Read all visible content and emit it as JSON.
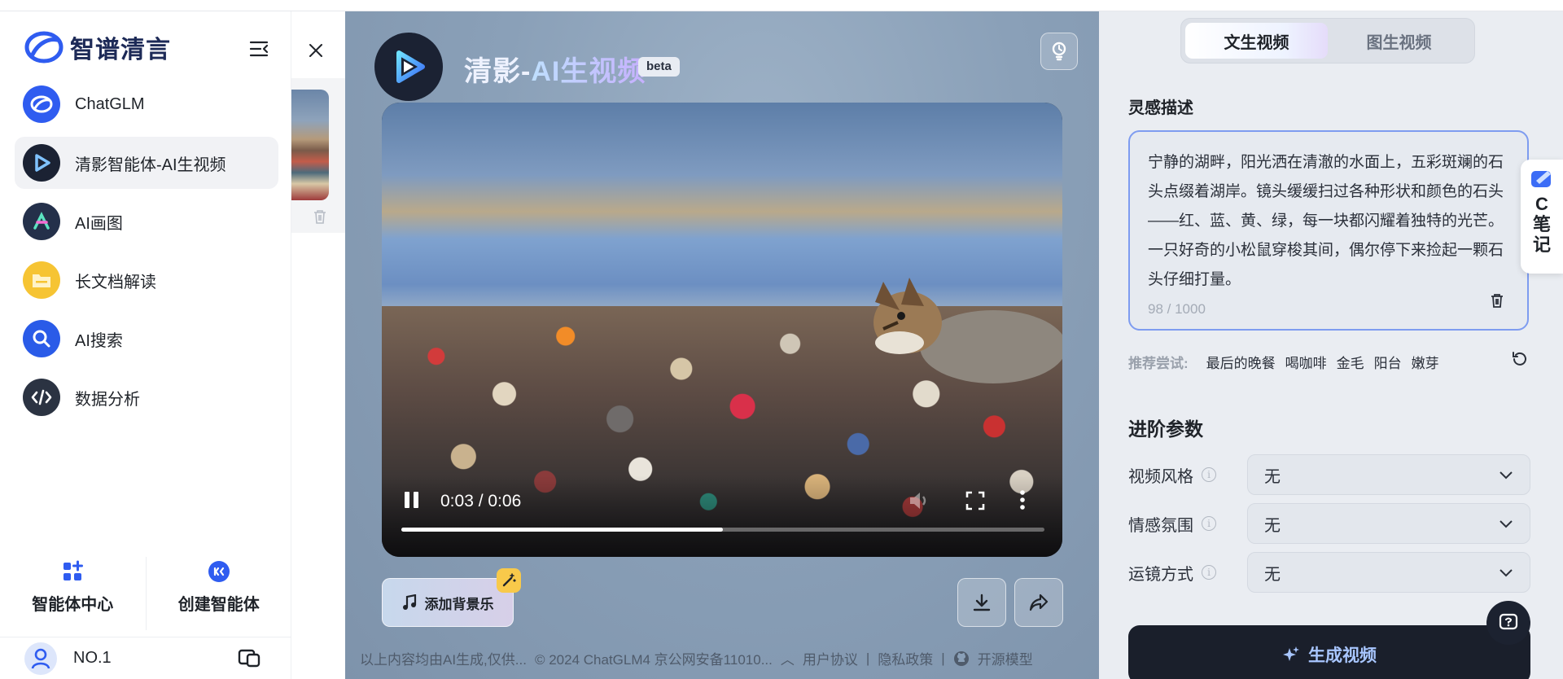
{
  "sidebar": {
    "brand": "智谱清言",
    "items": [
      {
        "label": "ChatGLM"
      },
      {
        "label": "清影智能体-AI生视频"
      },
      {
        "label": "AI画图"
      },
      {
        "label": "长文档解读"
      },
      {
        "label": "AI搜索"
      },
      {
        "label": "数据分析"
      }
    ],
    "tools": [
      {
        "label": "智能体中心"
      },
      {
        "label": "创建智能体"
      }
    ],
    "user": {
      "name": "NO.1"
    }
  },
  "app": {
    "title_main": "清影-",
    "title_grad": "AI生视频",
    "badge": "beta"
  },
  "video": {
    "time": "0:03 / 0:06",
    "progress": 0.5
  },
  "actions": {
    "bgm_label": "添加背景乐"
  },
  "footer": {
    "disclaimer": "以上内容均由AI生成,仅供...",
    "copyright": "© 2024 ChatGLM4 京公网安备11010...",
    "links": [
      "用户协议",
      "隐私政策",
      "开源模型"
    ]
  },
  "panel": {
    "tabs": [
      {
        "label": "文生视频",
        "active": true
      },
      {
        "label": "图生视频",
        "active": false
      }
    ],
    "prompt_title": "灵感描述",
    "prompt_text": "宁静的湖畔，阳光洒在清澈的水面上，五彩斑斓的石头点缀着湖岸。镜头缓缓扫过各种形状和颜色的石头——红、蓝、黄、绿，每一块都闪耀着独特的光芒。一只好奇的小松鼠穿梭其间，偶尔停下来捡起一颗石头仔细打量。",
    "prompt_count": "98 / 1000",
    "suggest_lead": "推荐尝试:",
    "suggestions": [
      "最后的晚餐",
      "喝咖啡",
      "金毛",
      "阳台",
      "嫩芽"
    ],
    "advanced_title": "进阶参数",
    "params": [
      {
        "label": "视频风格",
        "value": "无"
      },
      {
        "label": "情感氛围",
        "value": "无"
      },
      {
        "label": "运镜方式",
        "value": "无"
      }
    ],
    "generate_label": "生成视频"
  },
  "note_float": {
    "label": "C笔记"
  },
  "colors": {
    "accent": "#3b6cf6",
    "dark_button": "#1a1f2b",
    "panel_bg": "#eaedf2"
  }
}
